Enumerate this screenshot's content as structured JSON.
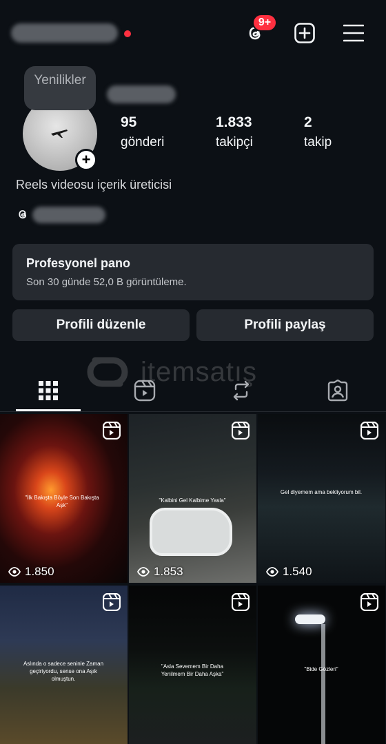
{
  "header": {
    "notification_badge": "9+",
    "icons": [
      "threads-icon",
      "add-post-icon",
      "menu-icon"
    ]
  },
  "profile": {
    "note": "Yenilikler",
    "stats": [
      {
        "value": "95",
        "label": "gönderi"
      },
      {
        "value": "1.833",
        "label": "takipçi"
      },
      {
        "value": "2",
        "label": "takip"
      }
    ],
    "bio": "Reels videosu içerik üreticisi"
  },
  "dashboard": {
    "title": "Profesyonel pano",
    "subtitle": "Son 30 günde 52,0 B görüntüleme."
  },
  "buttons": {
    "edit": "Profili düzenle",
    "share": "Profili paylaş"
  },
  "watermark": "itemsatış",
  "tabs": [
    "grid-icon",
    "reels-icon",
    "reposts-icon",
    "tagged-icon"
  ],
  "grid": [
    {
      "views": "1.850",
      "caption": "\"İlk Bakışta Böyle Son Bakışta Aşk\""
    },
    {
      "views": "1.853",
      "caption": "\"Kalbini Gel Kalbime Yasla\""
    },
    {
      "views": "1.540",
      "caption": "Gel diyemem ama bekliyorum bil."
    },
    {
      "views": "",
      "caption": "Aslında o sadece seninle Zaman geçiriyordu, sense ona Aşık olmuştun."
    },
    {
      "views": "",
      "caption": "\"Asla Sevemem Bir Daha Yenilmem Bir Daha Aşka\""
    },
    {
      "views": "",
      "caption": "\"Bide Gözleri\""
    }
  ]
}
